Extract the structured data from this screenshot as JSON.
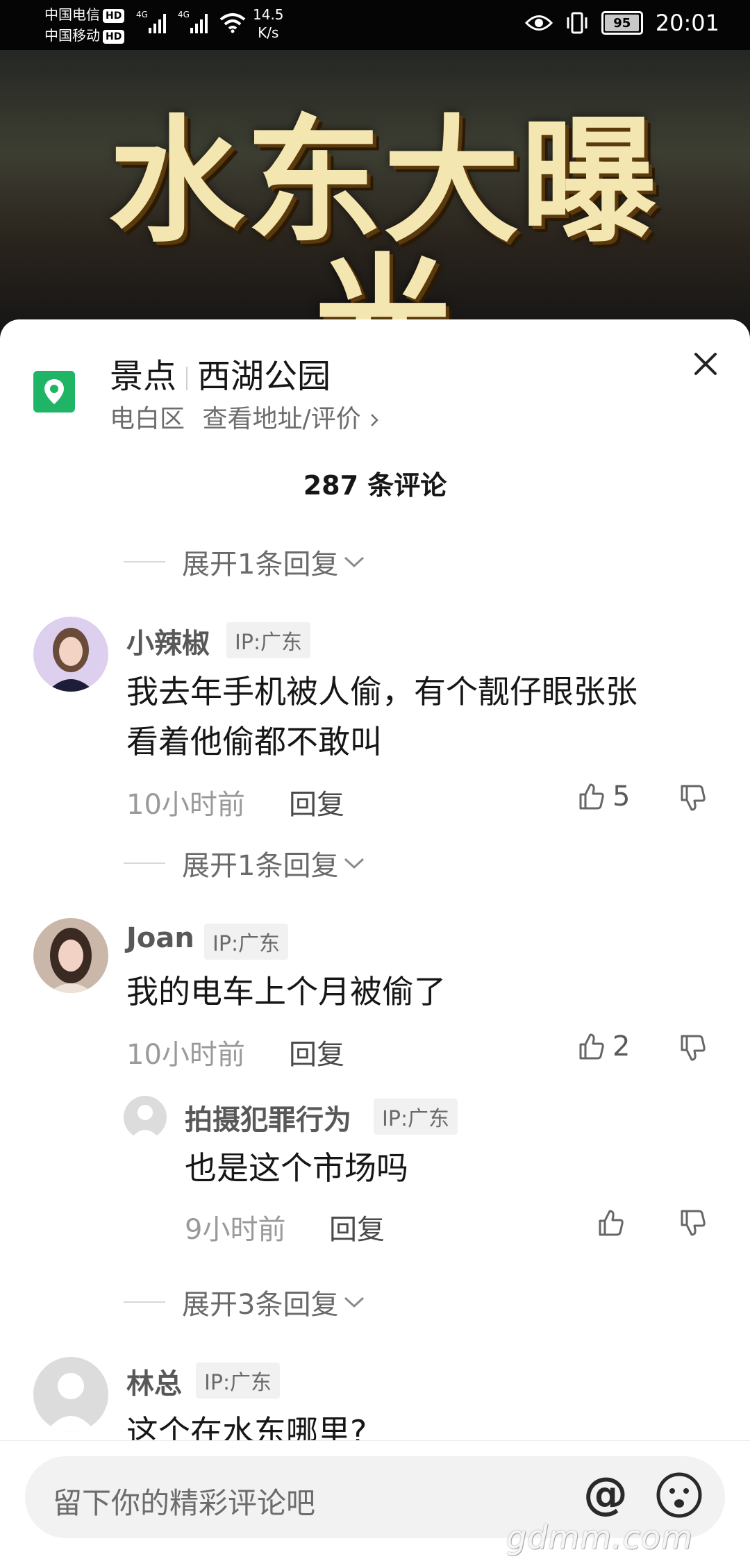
{
  "status_bar": {
    "carrier1": "中国电信",
    "carrier2": "中国移动",
    "hd": "HD",
    "net_type": "4G",
    "speed_value": "14.5",
    "speed_unit": "K/s",
    "battery": "95",
    "time": "20:01"
  },
  "video": {
    "title": "水东大曝光"
  },
  "location": {
    "category": "景点",
    "name": "西湖公园",
    "district": "电白区",
    "link": "查看地址/评价"
  },
  "comment_count": "287 条评论",
  "expand_top": "展开1条回复",
  "comments": [
    {
      "user": "小辣椒",
      "ip": "IP:广东",
      "text_line1": "我去年手机被人偷，有个靓仔眼张张",
      "text_line2": "看着他偷都不敢叫",
      "time": "10小时前",
      "reply": "回复",
      "likes": "5",
      "expand": "展开1条回复"
    },
    {
      "user": "Joan",
      "ip": "IP:广东",
      "text_line1": "我的电车上个月被偷了",
      "time": "10小时前",
      "reply": "回复",
      "likes": "2",
      "sub_reply": {
        "user": "拍摄犯罪行为",
        "ip": "IP:广东",
        "text": "也是这个市场吗",
        "time": "9小时前",
        "reply": "回复"
      },
      "expand": "展开3条回复"
    },
    {
      "user": "林总",
      "ip": "IP:广东",
      "text_line1": "这个在水东哪里?"
    }
  ],
  "input": {
    "placeholder": "留下你的精彩评论吧"
  },
  "watermark": "gdmm.com"
}
